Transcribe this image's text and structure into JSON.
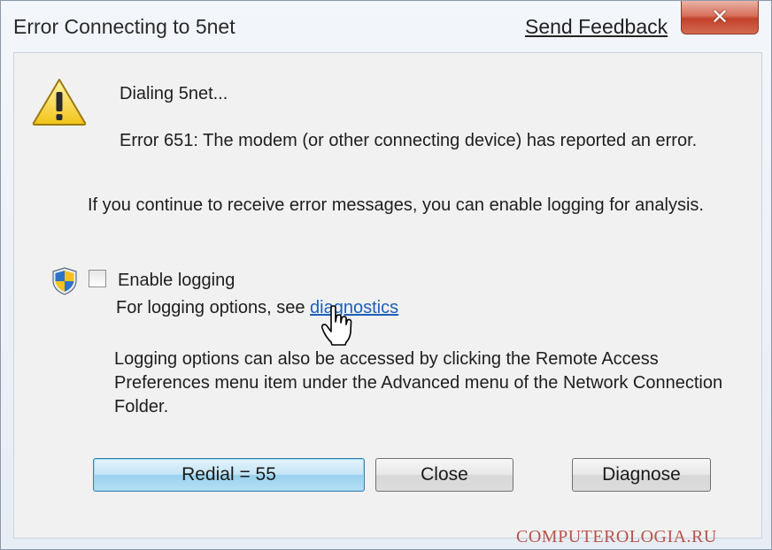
{
  "window": {
    "title": "Error Connecting to 5net",
    "send_feedback": "Send Feedback",
    "close_glyph": "✕"
  },
  "message": {
    "icon": "warning-icon",
    "dialing": "Dialing 5net...",
    "error": "Error 651: The modem (or other connecting device) has reported an error.",
    "continue": "If you continue to receive error messages, you can enable logging for analysis."
  },
  "logging": {
    "shield_icon": "uac-shield-icon",
    "checkbox_checked": false,
    "enable_label": "Enable logging",
    "options_prefix": "For logging options, see",
    "diagnostics_link": "diagnostics",
    "also_text": "Logging options can also be accessed by clicking the Remote Access Preferences menu item under the Advanced menu of the Network Connection Folder."
  },
  "buttons": {
    "redial": "Redial = 55",
    "close": "Close",
    "diagnose": "Diagnose"
  },
  "watermark": "COMPUTEROLOGIA.RU",
  "colors": {
    "link": "#1c5fb8",
    "close_button": "#c2422a",
    "default_button": "#98d1ef",
    "watermark": "#b8544a"
  }
}
